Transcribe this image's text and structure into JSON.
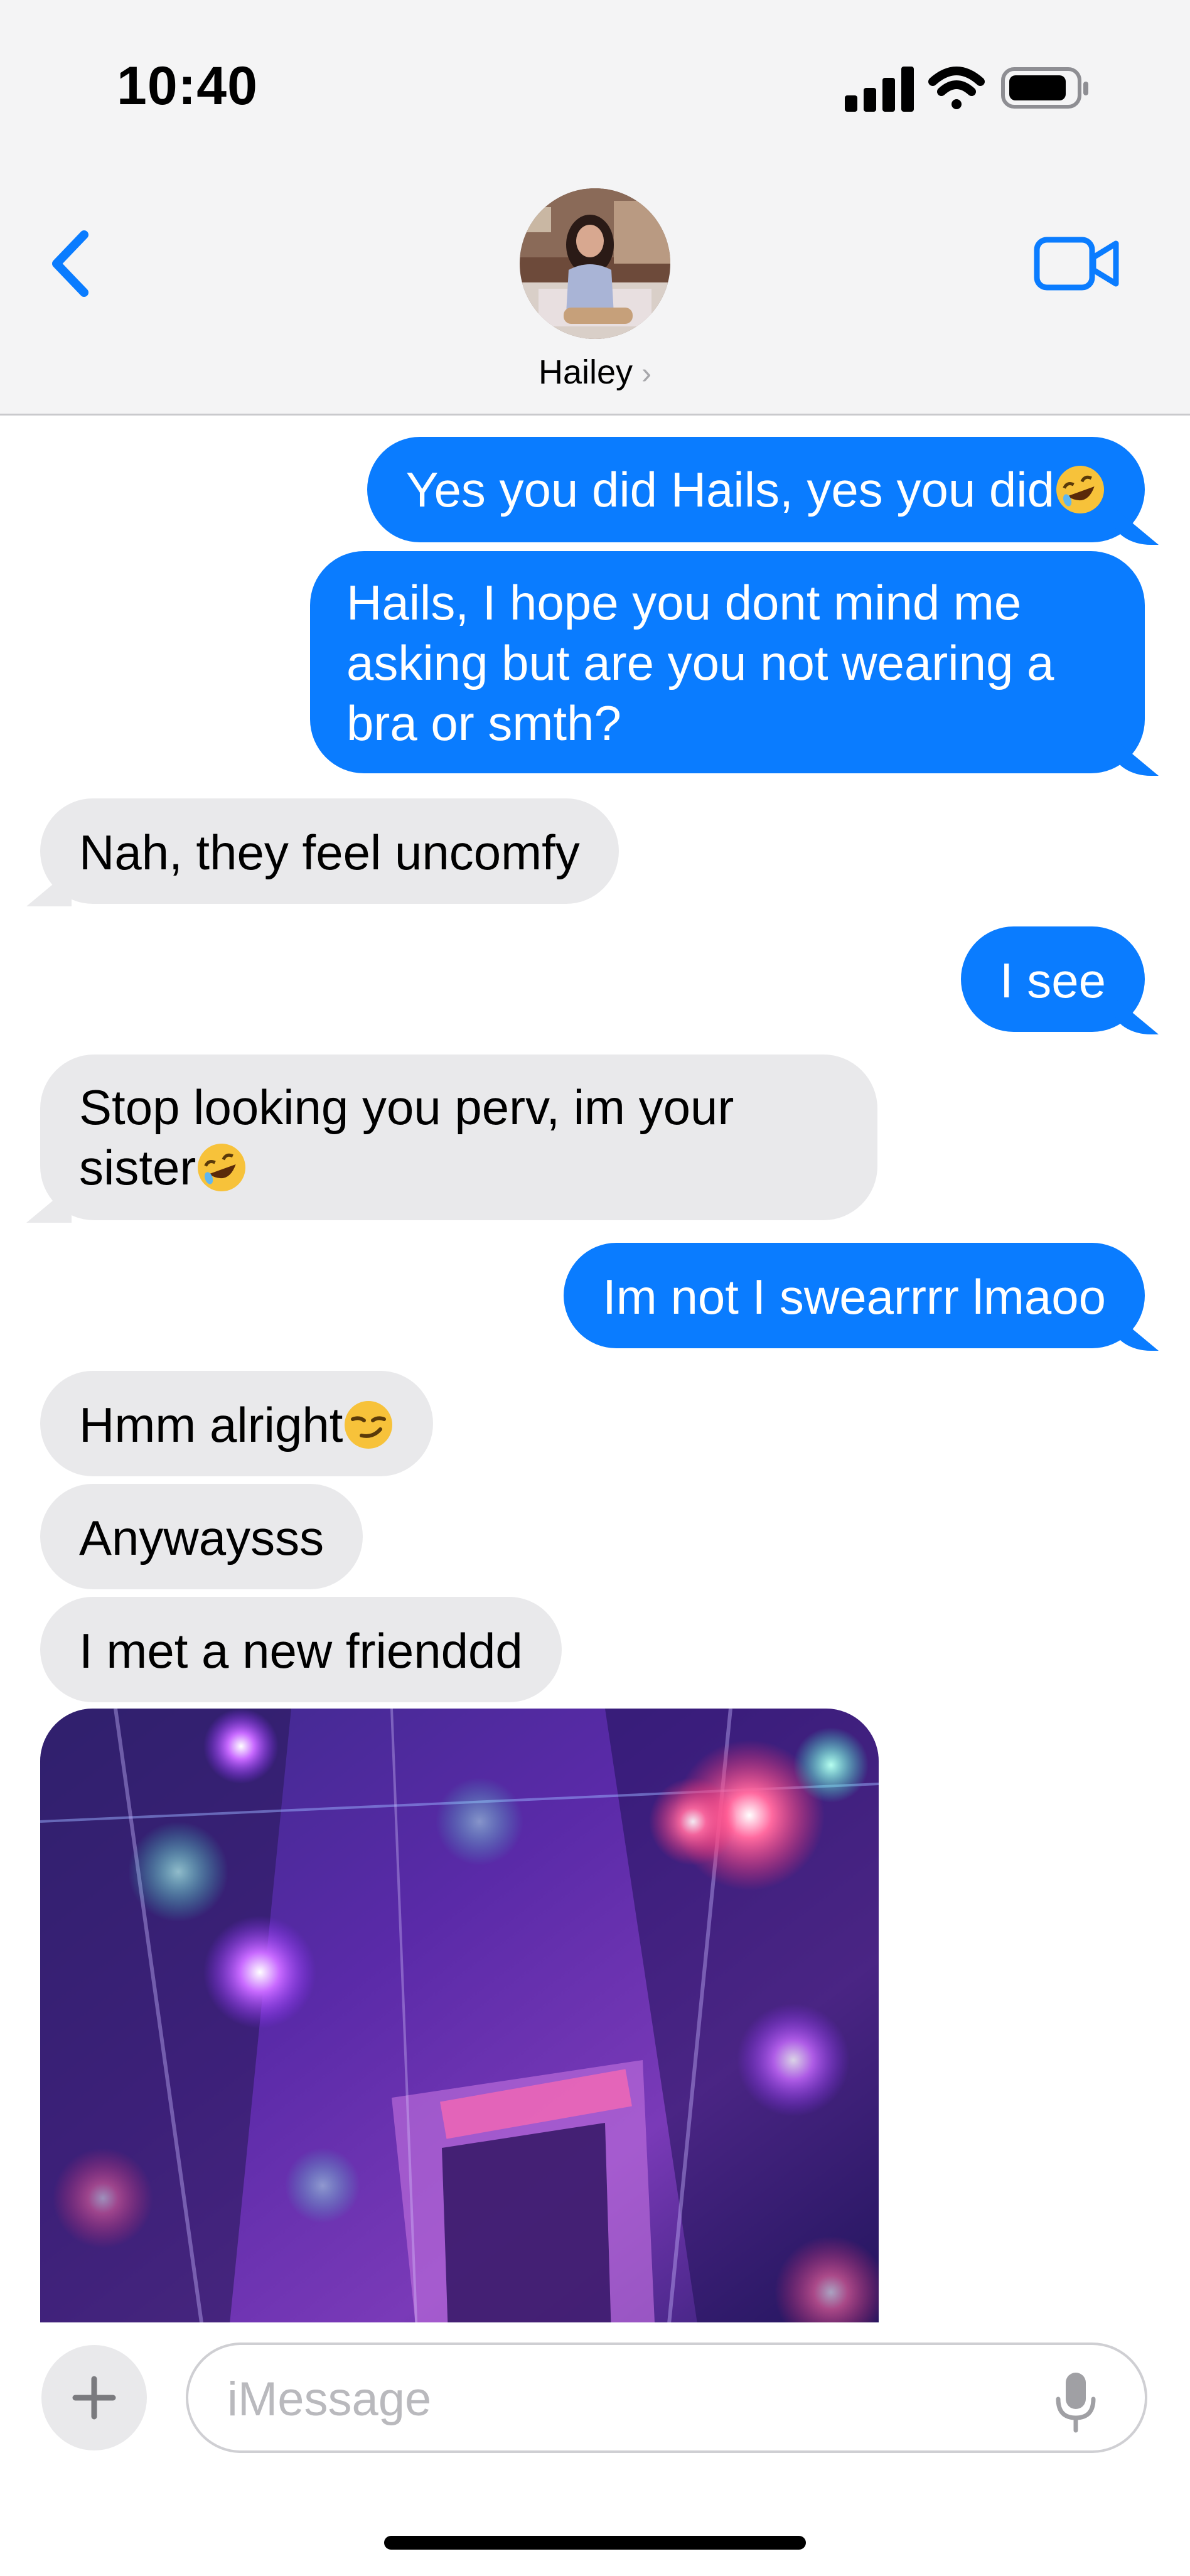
{
  "status_bar": {
    "time": "10:40"
  },
  "header": {
    "contact_name": "Hailey",
    "chevron": "›"
  },
  "colors": {
    "sent_bubble": "#0a7cff",
    "received_bubble": "#e9e9eb",
    "accent": "#0a7cff"
  },
  "messages": [
    {
      "direction": "sent",
      "text": "Yes you did Hails, yes you did",
      "emoji": "rolling-on-floor-laughing"
    },
    {
      "direction": "sent",
      "lines": [
        "Hails, I hope you dont mind me",
        "asking but are you not wearing a",
        "bra or smth?"
      ]
    },
    {
      "direction": "received",
      "text": "Nah, they feel uncomfy"
    },
    {
      "direction": "sent",
      "text": "I see"
    },
    {
      "direction": "received",
      "lines": [
        "Stop looking you perv, im your",
        "sister"
      ],
      "emoji": "rolling-on-floor-laughing"
    },
    {
      "direction": "sent",
      "text": "Im not I swearrrr lmaoo"
    },
    {
      "direction": "received",
      "text": "Hmm alright",
      "emoji": "smirking-face"
    },
    {
      "direction": "received",
      "text": "Anywaysss"
    },
    {
      "direction": "received",
      "text": "I met a new frienddd"
    },
    {
      "direction": "received",
      "type": "image",
      "subject": "colorful-neon-mirror-room"
    }
  ],
  "input": {
    "placeholder": "iMessage",
    "value": "",
    "plus_icon": "plus-icon",
    "mic_icon": "microphone-icon"
  }
}
